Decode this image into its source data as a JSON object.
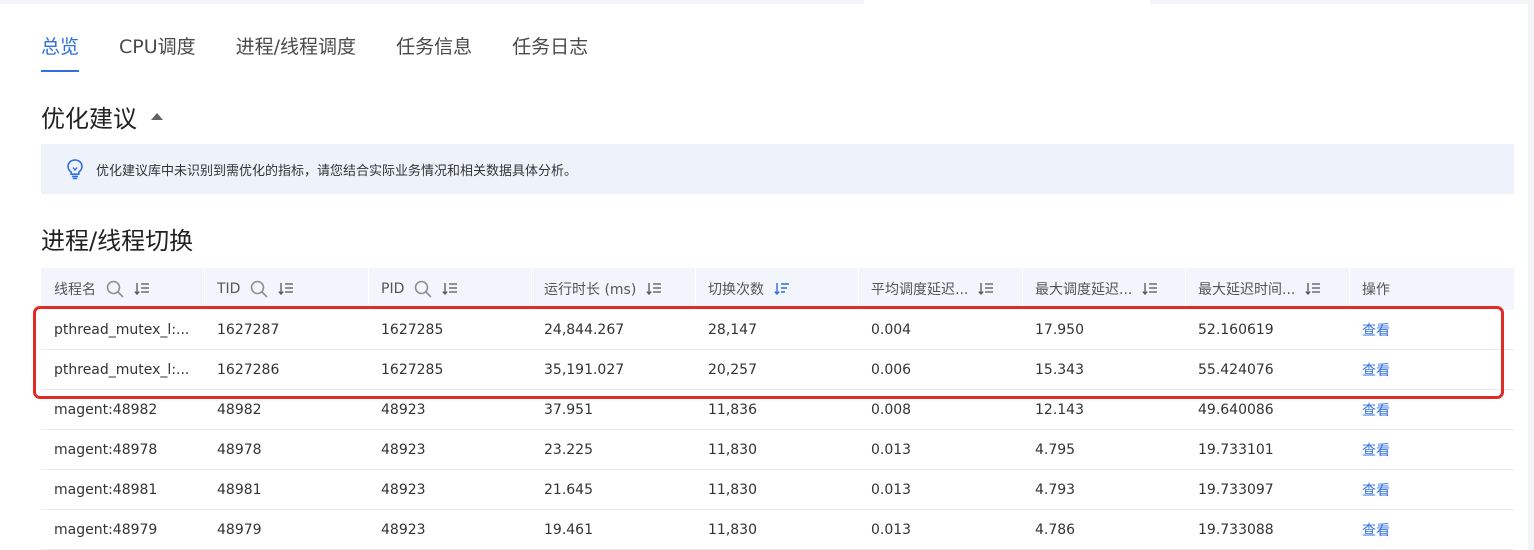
{
  "tabs": [
    {
      "label": "总览",
      "active": true
    },
    {
      "label": "CPU调度",
      "active": false
    },
    {
      "label": "进程/线程调度",
      "active": false
    },
    {
      "label": "任务信息",
      "active": false
    },
    {
      "label": "任务日志",
      "active": false
    }
  ],
  "optimization": {
    "title": "优化建议",
    "notice": "优化建议库中未识别到需优化的指标，请您结合实际业务情况和相关数据具体分析。"
  },
  "switch_section": {
    "title": "进程/线程切换",
    "columns": [
      {
        "label": "线程名",
        "search_icon": "search-icon",
        "sort_icon": "sort-icon"
      },
      {
        "label": "TID",
        "search_icon": "search-icon",
        "sort_icon": "sort-icon"
      },
      {
        "label": "PID",
        "search_icon": "search-icon",
        "sort_icon": "sort-icon"
      },
      {
        "label": "运行时长 (ms)",
        "sort_icon": "sort-icon"
      },
      {
        "label": "切换次数",
        "sort_icon": "sort-desc-active-icon"
      },
      {
        "label": "平均调度延迟...",
        "sort_icon": "sort-icon"
      },
      {
        "label": "最大调度延迟...",
        "sort_icon": "sort-icon"
      },
      {
        "label": "最大延迟时间...",
        "sort_icon": "sort-icon"
      },
      {
        "label": "操作"
      }
    ],
    "rows": [
      {
        "name": "pthread_mutex_l:...",
        "tid": "1627287",
        "pid": "1627285",
        "runtime": "24,844.267",
        "switches": "28,147",
        "avg_delay": "0.004",
        "max_delay": "17.950",
        "max_delay_time": "52.160619",
        "action": "查看"
      },
      {
        "name": "pthread_mutex_l:...",
        "tid": "1627286",
        "pid": "1627285",
        "runtime": "35,191.027",
        "switches": "20,257",
        "avg_delay": "0.006",
        "max_delay": "15.343",
        "max_delay_time": "55.424076",
        "action": "查看"
      },
      {
        "name": "magent:48982",
        "tid": "48982",
        "pid": "48923",
        "runtime": "37.951",
        "switches": "11,836",
        "avg_delay": "0.008",
        "max_delay": "12.143",
        "max_delay_time": "49.640086",
        "action": "查看"
      },
      {
        "name": "magent:48978",
        "tid": "48978",
        "pid": "48923",
        "runtime": "23.225",
        "switches": "11,830",
        "avg_delay": "0.013",
        "max_delay": "4.795",
        "max_delay_time": "19.733101",
        "action": "查看"
      },
      {
        "name": "magent:48981",
        "tid": "48981",
        "pid": "48923",
        "runtime": "21.645",
        "switches": "11,830",
        "avg_delay": "0.013",
        "max_delay": "4.793",
        "max_delay_time": "19.733097",
        "action": "查看"
      },
      {
        "name": "magent:48979",
        "tid": "48979",
        "pid": "48923",
        "runtime": "19.461",
        "switches": "11,830",
        "avg_delay": "0.013",
        "max_delay": "4.786",
        "max_delay_time": "19.733088",
        "action": "查看"
      }
    ]
  },
  "colors": {
    "accent": "#2f6fe0",
    "highlight_border": "#e02b26",
    "notice_bg": "#eef3fb",
    "header_bg": "#f2f5fb"
  }
}
